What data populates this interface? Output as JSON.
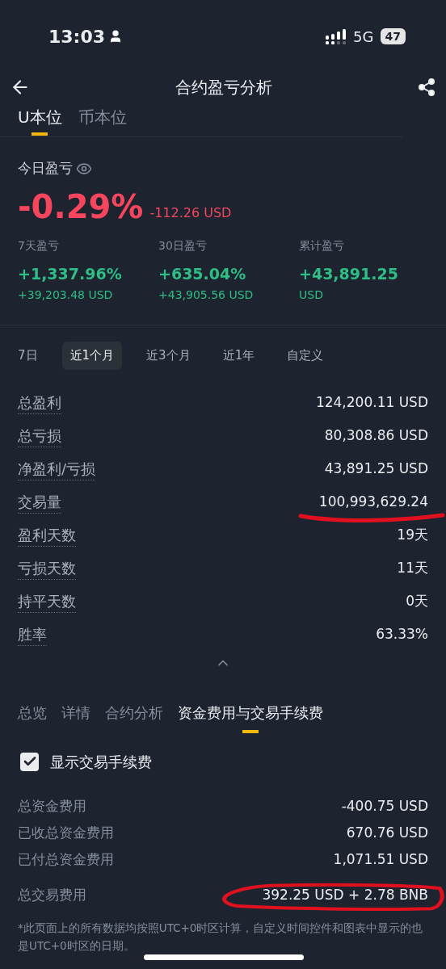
{
  "status_bar": {
    "time": "13:03",
    "network": "5G",
    "battery": "47"
  },
  "header": {
    "title": "合约盈亏分析"
  },
  "unit_tabs": [
    {
      "label": "U本位",
      "selected": true
    },
    {
      "label": "币本位",
      "selected": false
    }
  ],
  "today": {
    "label": "今日盈亏",
    "percent": "-0.29%",
    "amount": "-112.26 USD"
  },
  "summary": [
    {
      "label": "7天盈亏",
      "value": "+1,337.96%",
      "sub": "+39,203.48 USD"
    },
    {
      "label": "30日盈亏",
      "value": "+635.04%",
      "sub": "+43,905.56 USD"
    },
    {
      "label": "累计盈亏",
      "value": "+43,891.25",
      "sub": "USD"
    }
  ],
  "period_tabs": [
    {
      "label": "7日",
      "selected": false
    },
    {
      "label": "近1个月",
      "selected": true
    },
    {
      "label": "近3个月",
      "selected": false
    },
    {
      "label": "近1年",
      "selected": false
    },
    {
      "label": "自定义",
      "selected": false
    }
  ],
  "stats": [
    {
      "label": "总盈利",
      "value": "124,200.11 USD"
    },
    {
      "label": "总亏损",
      "value": "80,308.86 USD"
    },
    {
      "label": "净盈利/亏损",
      "value": "43,891.25 USD"
    },
    {
      "label": "交易量",
      "value": "100,993,629.24"
    },
    {
      "label": "盈利天数",
      "value": "19天"
    },
    {
      "label": "亏损天数",
      "value": "11天"
    },
    {
      "label": "持平天数",
      "value": "0天"
    },
    {
      "label": "胜率",
      "value": "63.33%"
    }
  ],
  "section_tabs": [
    {
      "label": "总览",
      "selected": false
    },
    {
      "label": "详情",
      "selected": false
    },
    {
      "label": "合约分析",
      "selected": false
    },
    {
      "label": "资金费用与交易手续费",
      "selected": true
    }
  ],
  "fee_toggle": {
    "label": "显示交易手续费",
    "checked": true
  },
  "fees": [
    {
      "label": "总资金费用",
      "value": "-400.75 USD"
    },
    {
      "label": "已收总资金费用",
      "value": "670.76 USD"
    },
    {
      "label": "已付总资金费用",
      "value": "1,071.51 USD"
    },
    {
      "label": "总交易费用",
      "value": "392.25 USD + 2.78 BNB"
    }
  ],
  "footnote": "*此页面上的所有数据均按照UTC+0时区计算，自定义时间控件和图表中显示的也是UTC+0时区的日期。"
}
